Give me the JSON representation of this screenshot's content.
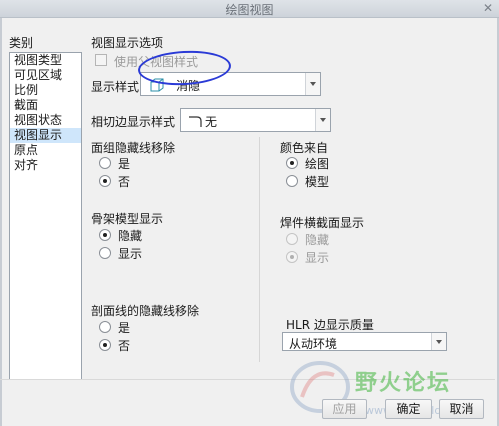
{
  "window": {
    "title": "绘图视图",
    "close_glyph": "✕"
  },
  "category": {
    "label": "类别",
    "items": [
      "视图类型",
      "可见区域",
      "比例",
      "截面",
      "视图状态",
      "视图显示",
      "原点",
      "对齐"
    ],
    "selected_index": 5
  },
  "display_options": {
    "group_label": "视图显示选项",
    "use_parent_style": {
      "label": "使用父视图样式",
      "checked": false,
      "enabled": false
    },
    "display_style": {
      "label": "显示样式",
      "value": "消隐"
    },
    "tangent_edge": {
      "label": "相切边显示样式",
      "value": "无"
    }
  },
  "hidden_line_removal": {
    "label": "面组隐藏线移除",
    "options": [
      "是",
      "否"
    ],
    "selected": "否"
  },
  "color_source": {
    "label": "颜色来自",
    "options": [
      "绘图",
      "模型"
    ],
    "selected": "绘图"
  },
  "skeleton_display": {
    "label": "骨架模型显示",
    "options": [
      "隐藏",
      "显示"
    ],
    "selected": "隐藏"
  },
  "weld_section": {
    "label": "焊件横截面显示",
    "options": [
      "隐藏",
      "显示"
    ],
    "selected": "显示",
    "enabled": false
  },
  "section_hidden_line": {
    "label": "剖面线的隐藏线移除",
    "options": [
      "是",
      "否"
    ],
    "selected": "否"
  },
  "hlr_quality": {
    "label": "HLR 边显示质量",
    "value": "从动环境"
  },
  "buttons": {
    "apply": "应用",
    "ok": "确定",
    "cancel": "取消"
  },
  "watermark": {
    "text": "野火论坛",
    "url": "www.proewildfire.cn"
  },
  "colors": {
    "annotation": "#2a3ad6",
    "selection": "#cfe6fb",
    "watermark": "#40b43c"
  }
}
